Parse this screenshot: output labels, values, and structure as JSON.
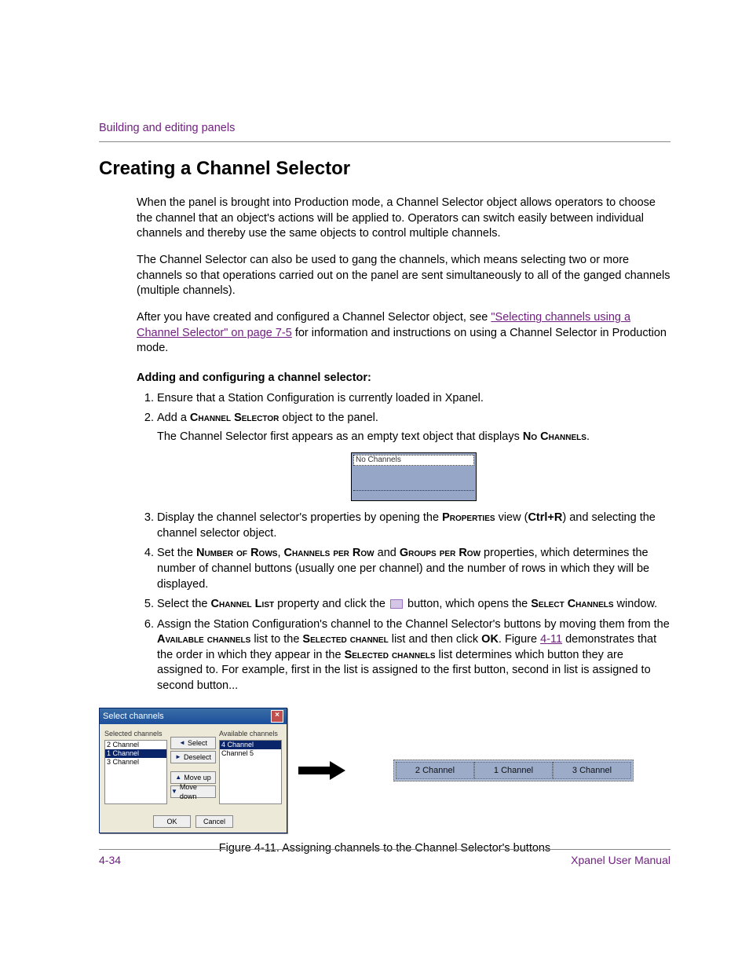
{
  "breadcrumb": "Building and editing panels",
  "title": "Creating a Channel Selector",
  "para1": "When the panel is brought into Production mode, a Channel Selector object allows operators to choose the channel that an object's actions will be applied to. Operators can switch easily between individual channels and thereby use the same objects to control multiple channels.",
  "para2": "The Channel Selector can also be used to gang the channels, which means selecting two or more channels so that operations carried out on the panel are sent simultaneously to all of the ganged channels (multiple channels).",
  "para3a": "After you have created and configured a Channel Selector object, see ",
  "para3link": "\"Selecting channels using a Channel Selector\" on page 7-5",
  "para3b": " for information and instructions on using a Channel Selector in Production mode.",
  "subhead": "Adding and configuring a channel selector:",
  "step1": "Ensure that a Station Configuration is currently loaded in Xpanel.",
  "step2a": "Add a ",
  "step2sc": "Channel Selector",
  "step2b": " object to the panel.",
  "step2sub_a": "The Channel Selector first appears as an empty text object that displays ",
  "step2sub_sc": "No Channels",
  "step2sub_b": ".",
  "nc_label": "No Channels",
  "step3a": "Display the channel selector's properties by opening the ",
  "step3sc": "Properties",
  "step3b": " view (",
  "step3key": "Ctrl+R",
  "step3c": ") and selecting the channel selector object.",
  "step4a": "Set the ",
  "step4sc1": "Number of Rows",
  "step4m1": ", ",
  "step4sc2": "Channels per Row",
  "step4m2": " and ",
  "step4sc3": "Groups per Row",
  "step4b": " properties, which determines the number of channel buttons (usually one per channel) and the number of rows in which they will be displayed.",
  "step5a": "Select the ",
  "step5sc1": "Channel List",
  "step5b": " property and click the ",
  "step5c": " button, which opens the ",
  "step5sc2": "Select Channels",
  "step5d": " window.",
  "step6a": "Assign the Station Configuration's channel to the Channel Selector's buttons by moving them from the ",
  "step6sc1": "Available channels",
  "step6m1": " list to the ",
  "step6sc2": "Selected channel",
  "step6m2": " list and then click ",
  "step6ok": "OK",
  "step6m3": ". Figure ",
  "step6fig": "4-11",
  "step6b": " demonstrates that the order in which they appear in the ",
  "step6sc3": "Selected channels",
  "step6c": " list determines which button they are assigned to. For example, first in the list is assigned to the first button, second in list is assigned to second button...",
  "dialog": {
    "title": "Select channels",
    "selected_label": "Selected channels",
    "available_label": "Available channels",
    "selected_items": [
      "2 Channel",
      "1 Channel",
      "3 Channel"
    ],
    "available_items": [
      "4 Channel",
      "Channel 5"
    ],
    "btn_select": "Select",
    "btn_deselect": "Deselect",
    "btn_moveup": "Move up",
    "btn_movedown": "Move down",
    "btn_ok": "OK",
    "btn_cancel": "Cancel"
  },
  "selector_buttons": [
    "2 Channel",
    "1 Channel",
    "3 Channel"
  ],
  "caption": "Figure 4-11. Assigning channels to the Channel Selector's buttons",
  "footer": {
    "page": "4-34",
    "manual": "Xpanel User Manual"
  }
}
